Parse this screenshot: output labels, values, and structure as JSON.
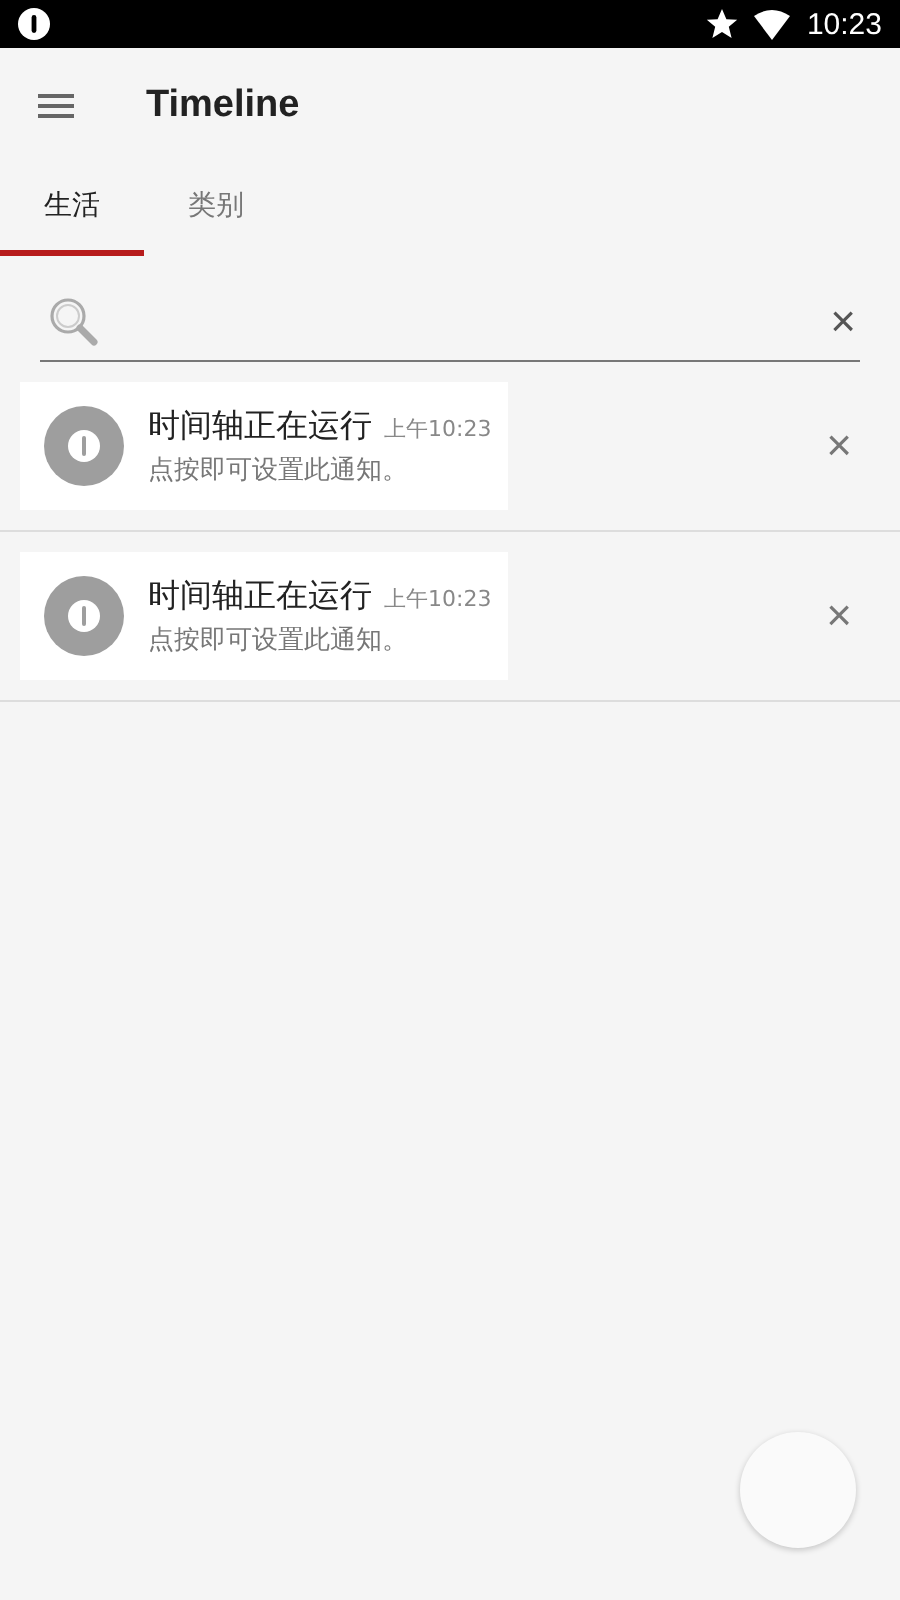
{
  "status_bar": {
    "time": "10:23"
  },
  "app_bar": {
    "title": "Timeline"
  },
  "tabs": [
    {
      "label": "生活",
      "selected": true
    },
    {
      "label": "类别",
      "selected": false
    }
  ],
  "search": {
    "clear": "×"
  },
  "notifications": [
    {
      "title": "时间轴正在运行",
      "time": "上午10:23",
      "text": "点按即可设置此通知。",
      "dismiss": "×"
    },
    {
      "title": "时间轴正在运行",
      "time": "上午10:23",
      "text": "点按即可设置此通知。",
      "dismiss": "×"
    }
  ]
}
